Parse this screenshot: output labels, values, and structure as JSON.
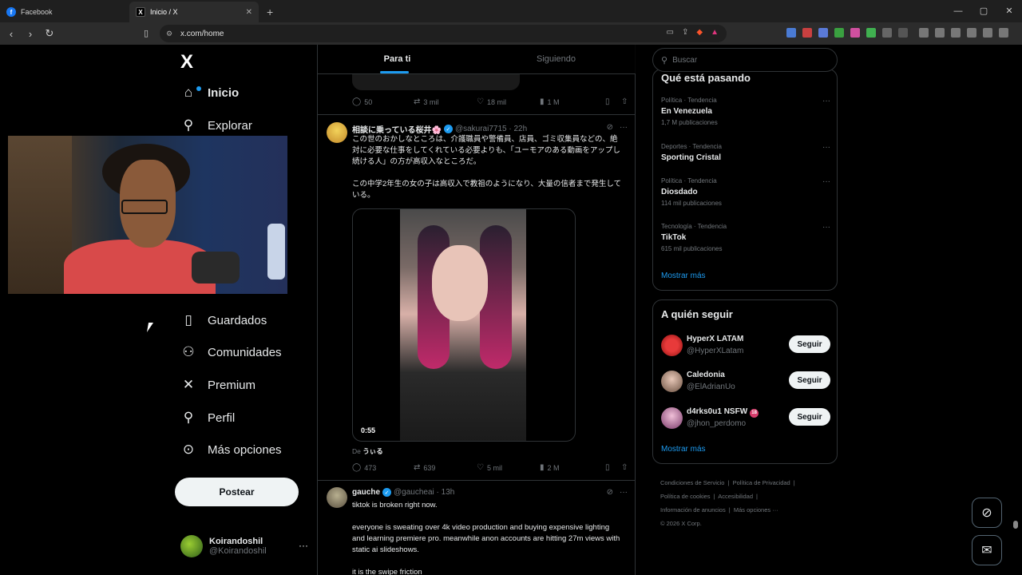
{
  "browser": {
    "tabs": [
      {
        "label": "Facebook",
        "active": false
      },
      {
        "label": "Inicio / X",
        "active": true
      }
    ],
    "url": "x.com/home"
  },
  "sidebar": {
    "logo": "X",
    "items": [
      {
        "label": "Inicio",
        "icon": "home-icon",
        "active": true
      },
      {
        "label": "Explorar",
        "icon": "search-icon"
      },
      {
        "label": "Guardados",
        "icon": "bookmark-icon"
      },
      {
        "label": "Comunidades",
        "icon": "communities-icon"
      },
      {
        "label": "Premium",
        "icon": "x-icon"
      },
      {
        "label": "Perfil",
        "icon": "person-icon"
      },
      {
        "label": "Más opciones",
        "icon": "more-circle-icon"
      }
    ],
    "post_label": "Postear",
    "account": {
      "name": "Koirandoshil",
      "handle": "@Koirandoshil"
    }
  },
  "timeline": {
    "tabs": [
      "Para ti",
      "Siguiendo"
    ],
    "prev_actions": {
      "replies": "50",
      "reposts": "3 mil",
      "likes": "18 mil",
      "views": "1 M"
    },
    "tweet1": {
      "name": "相談に乗っている桜井🌸",
      "handle": "@sakurai7715",
      "time": "22h",
      "text1": "この世のおかしなところは、介護職員や警備員、店員、ゴミ収集員などの、絶対に必要な仕事をしてくれている必要よりも、「ユーモアのある動画をアップし続ける人」の方が高収入なところだ。",
      "text2": "この中学2年生の女の子は高収入で教祖のようになり、大量の信者まで発生している。",
      "duration": "0:55",
      "from_label": "De",
      "from_user": "うぃる",
      "actions": {
        "replies": "473",
        "reposts": "639",
        "likes": "5 mil",
        "views": "2 M"
      }
    },
    "tweet2": {
      "name": "gauche",
      "handle": "@gaucheai",
      "time": "13h",
      "text1": "tiktok is broken right now.",
      "text2": "everyone is sweating over 4k video production and buying expensive lighting and learning premiere pro. meanwhile anon accounts are hitting 27m views with static ai slideshows.",
      "text3": "it is the swipe friction"
    }
  },
  "right": {
    "search_placeholder": "Buscar",
    "trends_title": "Qué está pasando",
    "trends": [
      {
        "category": "Política · Tendencia",
        "name": "En Venezuela",
        "count": "1,7 M publicaciones"
      },
      {
        "category": "Deportes · Tendencia",
        "name": "Sporting Cristal",
        "count": ""
      },
      {
        "category": "Política · Tendencia",
        "name": "Diosdado",
        "count": "114 mil publicaciones"
      },
      {
        "category": "Tecnología · Tendencia",
        "name": "TikTok",
        "count": "615 mil publicaciones"
      }
    ],
    "show_more": "Mostrar más",
    "follow_title": "A quién seguir",
    "follow": [
      {
        "name": "HyperX LATAM",
        "handle": "@HyperXLatam",
        "button": "Seguir"
      },
      {
        "name": "Caledonia",
        "handle": "@ElAdrianUo",
        "button": "Seguir"
      },
      {
        "name": "d4rks0u1 NSFW",
        "handle": "@jhon_perdomo",
        "button": "Seguir",
        "badge": "18"
      }
    ],
    "footer": [
      "Condiciones de Servicio",
      "Política de Privacidad",
      "Política de cookies",
      "Accesibilidad",
      "Información de anuncios",
      "Más opciones ···",
      "© 2026 X Corp."
    ]
  },
  "colors": {
    "accent": "#1d9bf0",
    "background": "#000000",
    "border": "#2f3336",
    "muted": "#71767b"
  }
}
